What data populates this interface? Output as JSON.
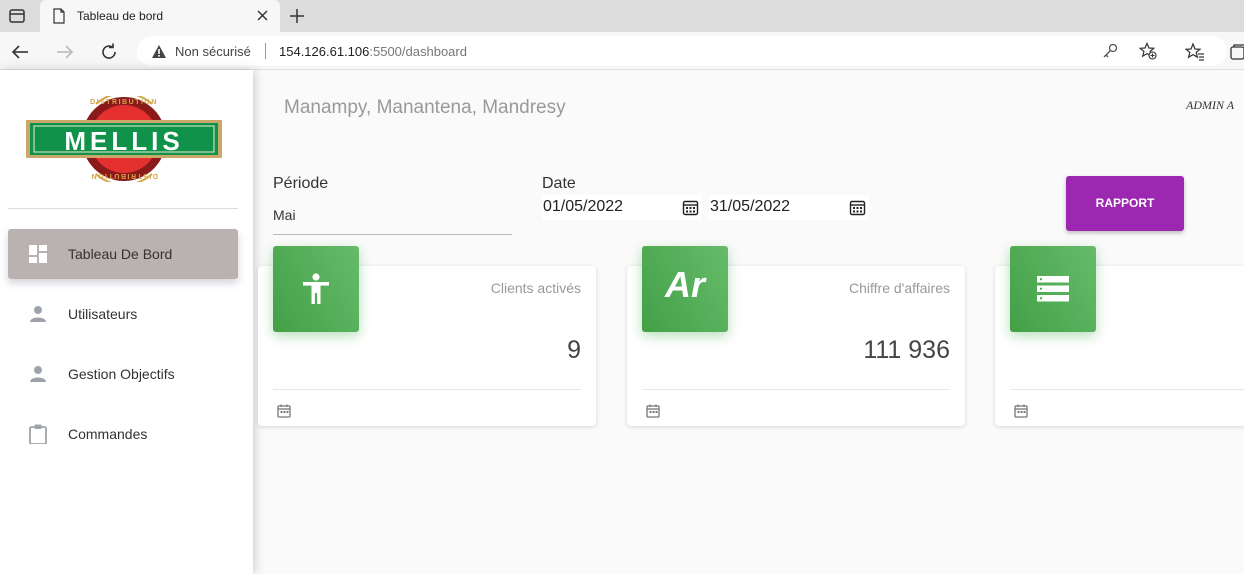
{
  "browser": {
    "tab_title": "Tableau de bord",
    "security_label": "Non sécurisé",
    "url_host": "154.126.61.106",
    "url_rest": ":5500/dashboard"
  },
  "sidebar": {
    "logo_text": "MELLIS",
    "logo_ring_text": "DISTRIBUTION",
    "items": [
      {
        "label": "Tableau De Bord",
        "icon": "dashboard-icon"
      },
      {
        "label": "Utilisateurs",
        "icon": "person-icon"
      },
      {
        "label": "Gestion Objectifs",
        "icon": "person-icon"
      },
      {
        "label": "Commandes",
        "icon": "clipboard-icon"
      }
    ]
  },
  "header": {
    "title": "Manampy, Manantena, Mandresy",
    "user": "ADMIN  A"
  },
  "filters": {
    "periode_label": "Période",
    "periode_value": "Mai",
    "date_label": "Date",
    "date_from": "01/05/2022",
    "date_to": "31/05/2022",
    "rapport_label": "RAPPORT"
  },
  "cards": [
    {
      "title": "Clients activés",
      "value": "9",
      "icon": "accessibility-icon"
    },
    {
      "title": "Chiffre d'affaires",
      "value": "111 936",
      "icon_text": "Ar"
    },
    {
      "title": "",
      "value": "",
      "icon": "list-icon"
    }
  ],
  "colors": {
    "accent": "#9c27b0",
    "card_badge": "#4caf50",
    "active_nav": "#b9b2b1"
  }
}
